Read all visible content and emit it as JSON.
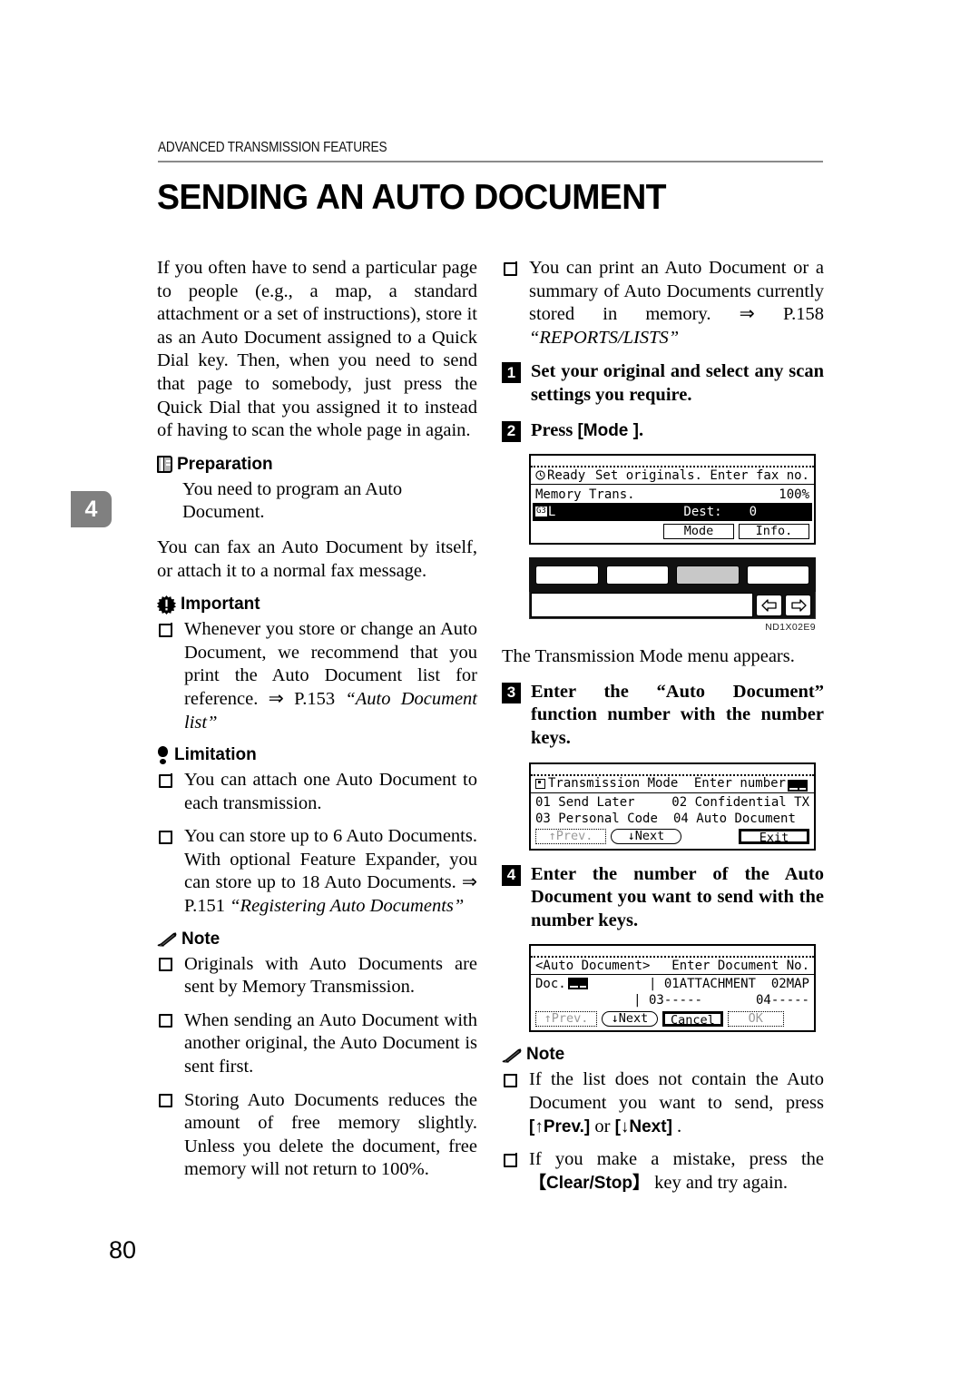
{
  "header": {
    "running_head": "ADVANCED TRANSMISSION FEATURES",
    "title": "SENDING AN AUTO DOCUMENT",
    "chapter_tab": "4",
    "page_number": "80"
  },
  "left_column": {
    "intro": "If you often have to send a particular page to people (e.g., a map, a standard attachment or a set of instructions), store it as an Auto Document assigned to a Quick Dial key. Then, when you need to send that page to somebody, just press the Quick Dial that you assigned it to instead of having to scan the whole page in again.",
    "preparation": {
      "heading": "Preparation",
      "icon": "book-icon",
      "body": "You need to program an Auto Document."
    },
    "fax_note": "You can fax an Auto Document by itself, or attach it to a normal fax message.",
    "important": {
      "heading": "Important",
      "icon": "important-icon",
      "items": [
        {
          "text": "Whenever you store or change an Auto Document, we recommend that you print the Auto Document list for reference. ",
          "ref_arrow": "⇒",
          "ref_page": " P.153 ",
          "ref_title": "“Auto Document list”"
        }
      ]
    },
    "limitation": {
      "heading": "Limitation",
      "icon": "limitation-icon",
      "items": [
        {
          "text": "You can attach one Auto Document to each transmission.",
          "ref_arrow": "",
          "ref_page": "",
          "ref_title": ""
        },
        {
          "text": "You can store up to 6 Auto Documents. With optional Feature Expander, you can store up to 18 Auto Documents. ",
          "ref_arrow": "⇒",
          "ref_page": " P.151 ",
          "ref_title": "“Registering Auto Documents”"
        }
      ]
    },
    "note": {
      "heading": "Note",
      "icon": "note-icon",
      "items": [
        "Originals with Auto Documents are sent by Memory Transmission.",
        "When sending an Auto Document with another original, the Auto Document is sent first.",
        "Storing Auto Documents reduces the amount of free memory slightly. Unless you delete the document, free memory will not return to 100%."
      ]
    }
  },
  "right_column": {
    "print_note": {
      "text": "You can print an Auto Document or a summary of Auto Documents currently stored in memory. ",
      "ref_arrow": "⇒",
      "ref_page": " P.158 ",
      "ref_title": "“REPORTS/LISTS”"
    },
    "steps": [
      {
        "num": "1",
        "text": "Set your original and select any scan settings you require."
      },
      {
        "num": "2",
        "text_before": "Press ",
        "keycap": "[Mode ]",
        "text_after": "."
      },
      {
        "num": "3",
        "text": "Enter the “Auto Document” function number with the number keys."
      },
      {
        "num": "4",
        "text": "Enter the number of the Auto Document you want to send with the number keys."
      }
    ],
    "lcd_standby": {
      "status_icon": "clock-icon",
      "status": "Ready",
      "prompt": "Set originals. Enter fax no.",
      "mode_label": "Memory Trans.",
      "memory_pct": "100%",
      "line_badge": "G3",
      "line_letter": "L",
      "dest_label": "Dest:",
      "dest_value": "0",
      "btn_mode": "Mode",
      "btn_info": "Info."
    },
    "panel_figure": {
      "caption": "ND1X02E9",
      "selected_key_index": 2,
      "left_arrow": "left-arrow-key",
      "right_arrow": "right-arrow-key"
    },
    "menu_appears": "The Transmission Mode menu appears.",
    "lcd_txmode": {
      "title": "Transmission Mode",
      "prompt": "Enter number",
      "entry_field": "__",
      "options": [
        {
          "num": "01",
          "label": "Send Later"
        },
        {
          "num": "02",
          "label": "Confidential TX"
        },
        {
          "num": "03",
          "label": "Personal Code"
        },
        {
          "num": "04",
          "label": "Auto Document"
        }
      ],
      "btn_prev": "↑Prev.",
      "btn_next": "↓Next",
      "btn_exit": "Exit"
    },
    "lcd_autodoc": {
      "title": "<Auto Document>",
      "prompt": "Enter Document No.",
      "doc_label": "Doc.",
      "doc_field": "__",
      "entries_row1": [
        {
          "num": "01",
          "name": "ATTACHMENT"
        },
        {
          "num": "02",
          "name": "MAP"
        }
      ],
      "entries_row2": [
        {
          "num": "03",
          "name": "-----"
        },
        {
          "num": "04",
          "name": "-----"
        }
      ],
      "btn_prev": "↑Prev.",
      "btn_next": "↓Next",
      "btn_cancel": "Cancel",
      "btn_ok": "OK"
    },
    "note": {
      "heading": "Note",
      "icon": "note-icon",
      "items": [
        {
          "text_before": "If the list does not contain the Auto Document you want to send, press ",
          "keycap1": "[↑Prev.]",
          "mid": " or ",
          "keycap2": "[↓Next]",
          "text_after": " ."
        },
        {
          "text_before": "If you make a mistake, press the ",
          "keycap1": "【Clear/Stop】",
          "mid": "",
          "keycap2": "",
          "text_after": " key and try again."
        }
      ]
    }
  },
  "colors": {
    "tab_gray": "#808080",
    "rule_gray": "#8a8a8a",
    "ink": "#000000"
  }
}
